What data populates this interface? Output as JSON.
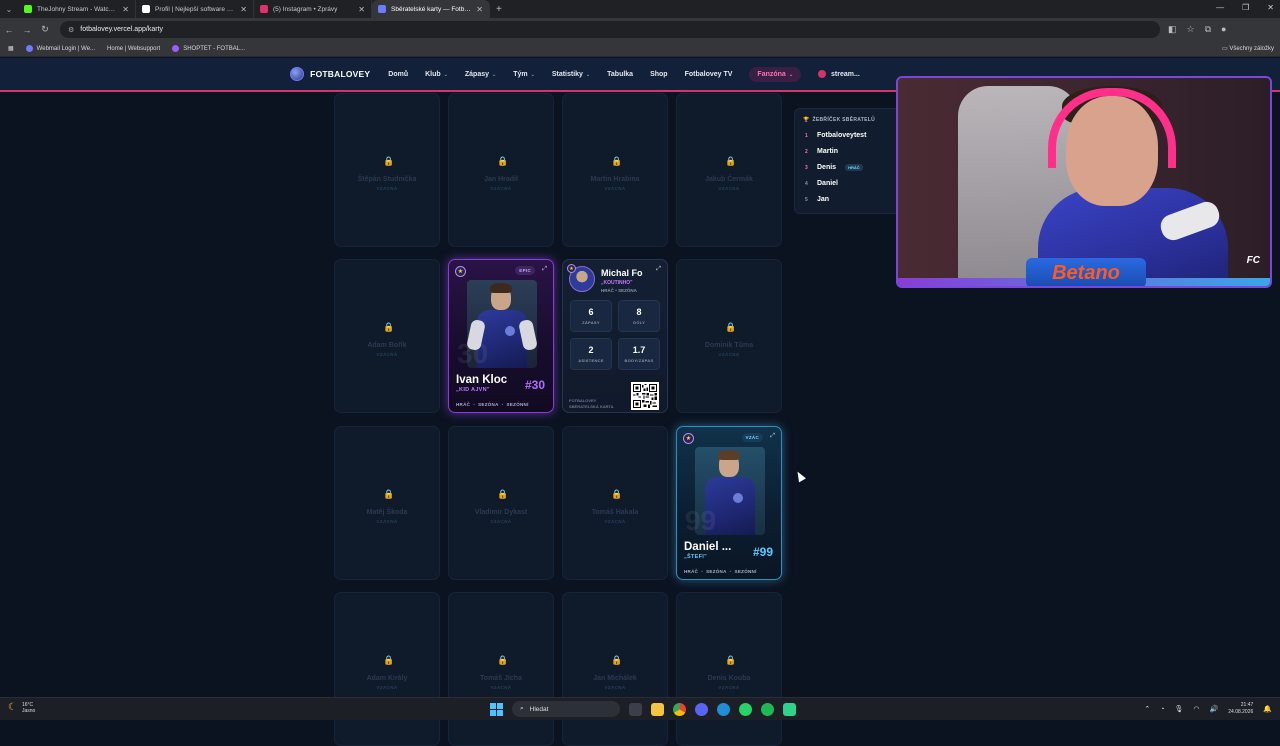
{
  "browser": {
    "tabs": [
      {
        "title": "TheJohny Stream - Watch Live",
        "color": "#53fc18",
        "active": false
      },
      {
        "title": "Profil | Nejlepší software pro vy",
        "color": "#ffffff",
        "active": false
      },
      {
        "title": "(5) Instagram • Zprávy",
        "color": "#e1306c",
        "active": false
      },
      {
        "title": "Sběratelské karty — Fotbalovey",
        "color": "#6b7cff",
        "active": true
      }
    ],
    "url": "fotbalovey.vercel.app/karty",
    "bookmarks": [
      "Webmail Login | We...",
      "Home | Websupport",
      "SHOPTET - FOTBAL..."
    ],
    "bookmarks_right": "Všechny záložky"
  },
  "site": {
    "brand": "FOTBALOVEY",
    "nav": [
      {
        "label": "Domů",
        "dropdown": false
      },
      {
        "label": "Klub",
        "dropdown": true
      },
      {
        "label": "Zápasy",
        "dropdown": true
      },
      {
        "label": "Tým",
        "dropdown": true
      },
      {
        "label": "Statistiky",
        "dropdown": true
      },
      {
        "label": "Tabulka",
        "dropdown": false
      },
      {
        "label": "Shop",
        "dropdown": false
      },
      {
        "label": "Fotbalovey TV",
        "dropdown": false
      }
    ],
    "fanzone": "Fanzóna",
    "user": "stream..."
  },
  "cards": {
    "locked": [
      {
        "name": "Štěpán Studnička",
        "rarity": "VZÁCNÁ"
      },
      {
        "name": "Jan Hradil",
        "rarity": "VZÁCNÁ"
      },
      {
        "name": "Martin Hrabina",
        "rarity": "VZÁCNÁ"
      },
      {
        "name": "Jakub Čermák",
        "rarity": "VZÁCNÁ"
      },
      {
        "name": "Adam Bořík",
        "rarity": "VZÁCNÁ"
      },
      {
        "name": "Dominik Tůma",
        "rarity": "VZÁCNÁ"
      },
      {
        "name": "Matěj Škoda",
        "rarity": "VZÁCNÁ"
      },
      {
        "name": "Vladimír Dykast",
        "rarity": "VZÁCNÁ"
      },
      {
        "name": "Tomáš Hakala",
        "rarity": "VZÁCNÁ"
      },
      {
        "name": "Adam Király",
        "rarity": "VZÁCNÁ"
      },
      {
        "name": "Tomáš Jícha",
        "rarity": "VZÁCNÁ"
      },
      {
        "name": "Jan Michálek",
        "rarity": "VZÁCNÁ"
      },
      {
        "name": "Denis Kouba",
        "rarity": "VZÁCNÁ"
      }
    ],
    "ivan": {
      "name": "Ivan Kloc",
      "nick": "„KID AJVN\"",
      "number": "#30",
      "ghost": "30",
      "rarity": "EPIC",
      "meta": [
        "HRÁČ",
        "SEZÓNA",
        "SEZÓNNÍ"
      ]
    },
    "michal": {
      "name": "Michal Fo",
      "nick": "„KOUTINHO\"",
      "meta": [
        "HRÁČ",
        "SEZÓNA"
      ],
      "stats": [
        {
          "value": "6",
          "label": "ZÁPASY"
        },
        {
          "value": "8",
          "label": "GÓLY"
        },
        {
          "value": "2",
          "label": "ASISTENCE"
        },
        {
          "value": "1.7",
          "label": "BODY/ZÁPAS"
        }
      ],
      "footer": [
        "FOTBALOVEY",
        "SBĚRATELSKÁ KARTA"
      ]
    },
    "daniel": {
      "name": "Daniel ...",
      "nick": "„ŠTEFI\"",
      "number": "#99",
      "ghost": "99",
      "rarity": "VZÁC",
      "meta": [
        "HRÁČ",
        "SEZÓNA",
        "SEZÓNNÍ"
      ]
    }
  },
  "leaderboard": {
    "title": "ŽEBŘÍČEK SBĚRATELŮ",
    "rows": [
      {
        "rank": "1",
        "name": "Fotbaloveytest",
        "tag": ""
      },
      {
        "rank": "2",
        "name": "Martin",
        "tag": ""
      },
      {
        "rank": "3",
        "name": "Denis",
        "tag": "HRÁČ"
      },
      {
        "rank": "4",
        "name": "Daniel",
        "tag": ""
      },
      {
        "rank": "5",
        "name": "Jan",
        "tag": ""
      }
    ]
  },
  "overlay": {
    "sponsor": "Betano",
    "corner": "FC"
  },
  "taskbar": {
    "weather_temp": "16°C",
    "weather_desc": "Jasno",
    "search": "Hledat",
    "time": "21:47",
    "date": "24.08.2026"
  }
}
